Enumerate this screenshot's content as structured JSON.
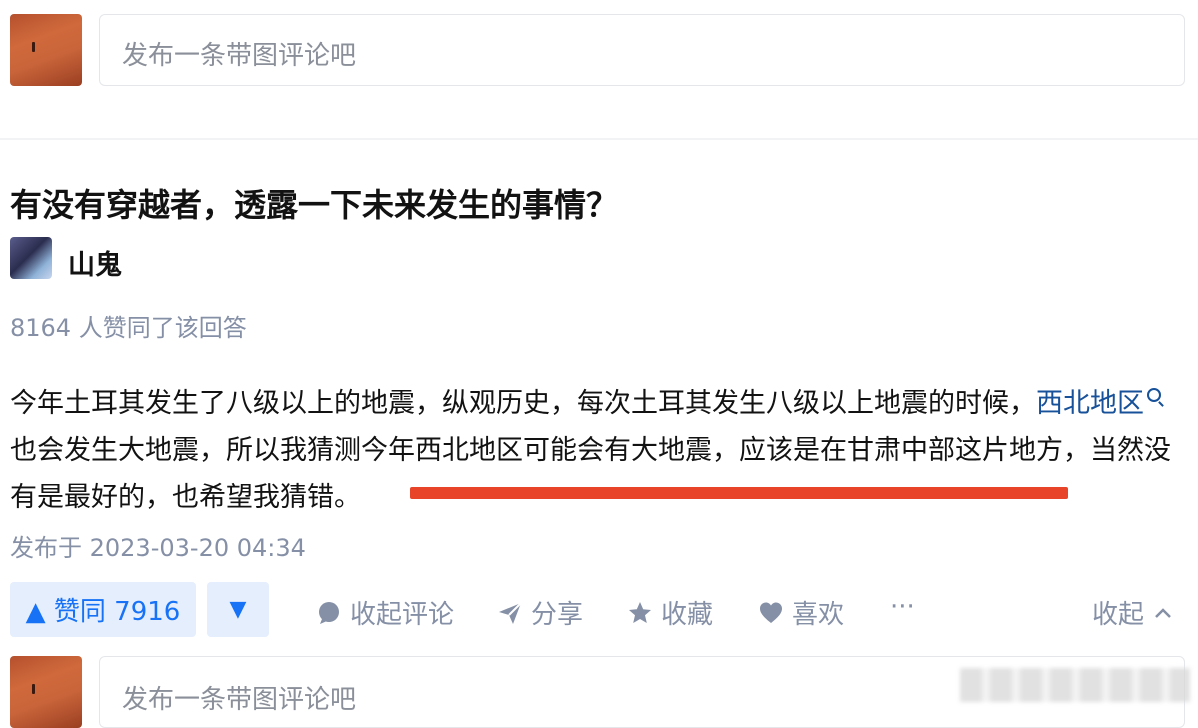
{
  "top_comment": {
    "placeholder": "发布一条带图评论吧"
  },
  "question": {
    "title": "有没有穿越者，透露一下未来发生的事情？"
  },
  "answer": {
    "author_name": "山鬼",
    "votes_line": "8164 人赞同了该回答",
    "body_part1": "今年土耳其发生了八级以上的地震，纵观历史，每次土耳其发生八级以上地震的时候，",
    "body_link": "西北地区",
    "body_part2": "也会发生大地震，所以我猜测今年西北地区可能会有大地震，应该是在甘肃中部这片地方，当然没有是最好的，也希望我猜错。",
    "publish_time": "发布于 2023-03-20 04:34"
  },
  "actions": {
    "vote_up_label": "▲ 赞同 7916",
    "vote_down_label": "▼",
    "collapse_comments": "收起评论",
    "share": "分享",
    "favorite": "收藏",
    "like": "喜欢",
    "more": "···",
    "collapse": "收起"
  },
  "bottom_comment": {
    "placeholder": "发布一条带图评论吧"
  },
  "colors": {
    "accent_blue": "#1772f6",
    "link_blue": "#175199",
    "meta_gray": "#8590a6",
    "highlight_red": "#e8442a"
  }
}
